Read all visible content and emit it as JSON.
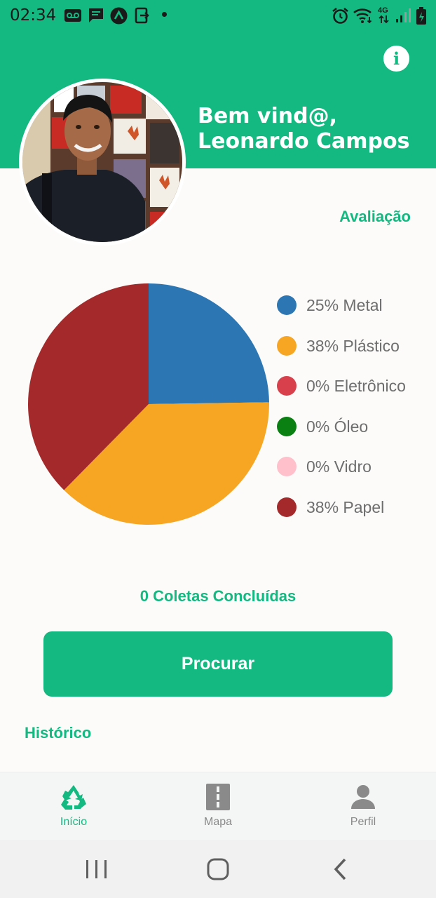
{
  "status_bar": {
    "time": "02:34",
    "network": "4G"
  },
  "header": {
    "welcome_line1": "Bem vind@,",
    "welcome_line2": "Leonardo Campos",
    "info_icon": "i"
  },
  "section_avaliacao": "Avaliação",
  "chart_data": {
    "type": "pie",
    "slices": [
      {
        "label": "Metal",
        "percent": 25,
        "color": "#2c76b4",
        "legend": "25% Metal"
      },
      {
        "label": "Plástico",
        "percent": 38,
        "color": "#f6a623",
        "legend": "38% Plástico"
      },
      {
        "label": "Eletrônico",
        "percent": 0,
        "color": "#d8404b",
        "legend": "0% Eletrônico"
      },
      {
        "label": "Óleo",
        "percent": 0,
        "color": "#0a7f12",
        "legend": "0% Óleo"
      },
      {
        "label": "Vidro",
        "percent": 0,
        "color": "#ffc0cb",
        "legend": "0% Vidro"
      },
      {
        "label": "Papel",
        "percent": 38,
        "color": "#a4292b",
        "legend": "38% Papel"
      }
    ]
  },
  "coletas_label": "0 Coletas Concluídas",
  "procurar_label": "Procurar",
  "section_historico": "Histórico",
  "bottom_nav": {
    "items": [
      {
        "label": "Início",
        "icon": "recycle-icon",
        "active": true
      },
      {
        "label": "Mapa",
        "icon": "road-icon",
        "active": false
      },
      {
        "label": "Perfil",
        "icon": "person-icon",
        "active": false
      }
    ]
  },
  "colors": {
    "accent": "#13b981",
    "legend_text": "#6e6e6e",
    "nav_inactive": "#888888"
  }
}
